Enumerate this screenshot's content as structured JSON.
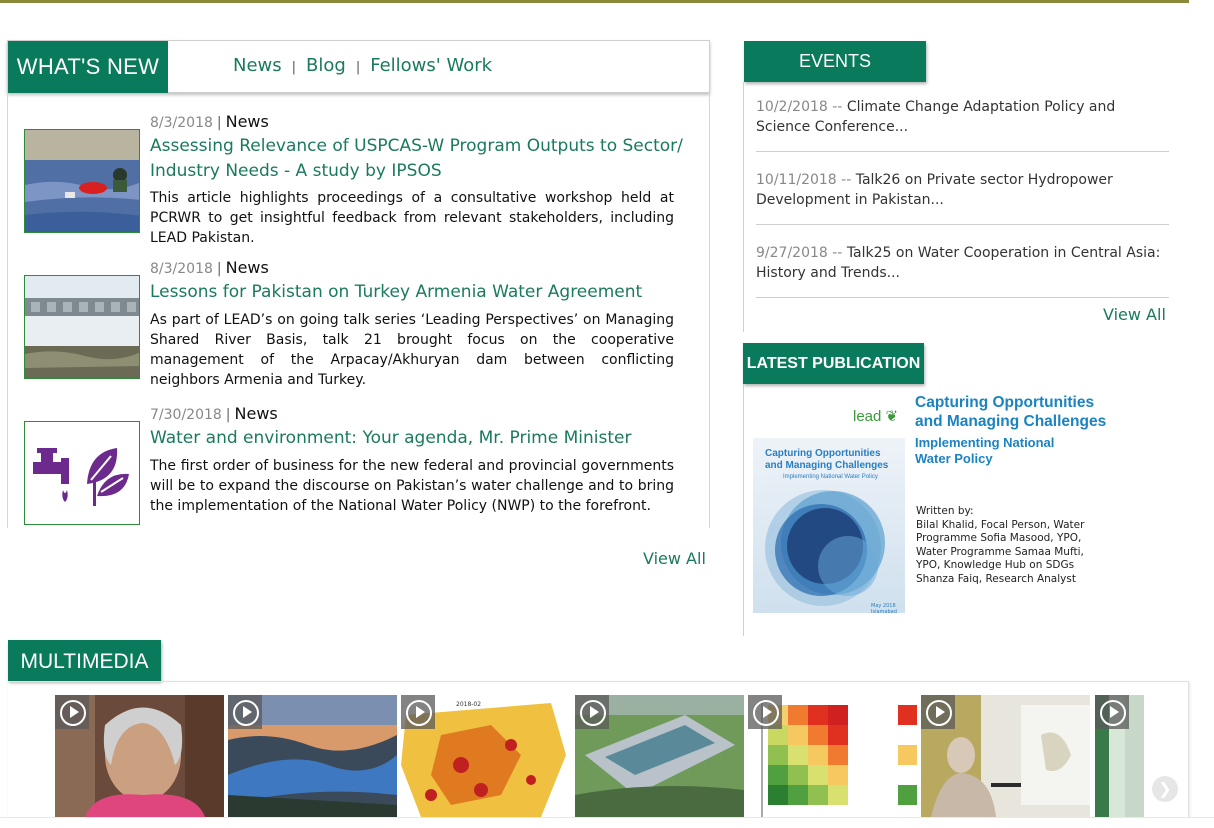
{
  "whats_new": {
    "title": "WHAT'S NEW",
    "tabs": [
      "News",
      "Blog",
      "Fellows' Work"
    ],
    "tab_separator": "|",
    "articles": [
      {
        "date": "8/3/2018",
        "category": "News",
        "title": "Assessing Relevance of USPCAS-W Program Outputs to Sector/ Industry Needs - A study by IPSOS",
        "body": "This article highlights proceedings of a consultative workshop held at PCRWR to get insightful feedback from relevant stakeholders, including LEAD Pakistan."
      },
      {
        "date": "8/3/2018",
        "category": "News",
        "title": "Lessons for Pakistan on Turkey Armenia Water Agreement",
        "body": "As part of LEAD’s on going talk series ‘Leading Perspectives’ on Managing Shared River Basis, talk 21 brought focus on the cooperative management of the Arpacay/Akhuryan dam between conflicting neighbors Armenia and Turkey."
      },
      {
        "date": "7/30/2018",
        "category": "News",
        "title": "Water and environment: Your agenda, Mr. Prime Minister",
        "body": "The first order of business for the new federal and provincial governments will be to expand the discourse on Pakistan’s water challenge and to bring the implementation of the National Water Policy (NWP) to the forefront."
      }
    ],
    "view_all": "View All"
  },
  "events": {
    "title": "EVENTS",
    "items": [
      {
        "date": "10/2/2018",
        "sep": " -- ",
        "text": "Climate Change Adaptation Policy and Science Conference..."
      },
      {
        "date": "10/11/2018",
        "sep": " -- ",
        "text": "Talk26 on Private sector Hydropower Development in Pakistan..."
      },
      {
        "date": "9/27/2018",
        "sep": " -- ",
        "text": "Talk25 on Water Cooperation in Central Asia: History and Trends..."
      }
    ],
    "view_all": "View All"
  },
  "latest_publication": {
    "title": "LATEST PUBLICATION",
    "logo_text": "lead",
    "heading": "Capturing Opportunities and Managing Challenges",
    "subheading": "Implementing National Water Policy",
    "cover_title": "Capturing Opportunities and Managing Challenges",
    "cover_subtitle": "Implementing National Water Policy",
    "cover_date": "May 2018 Islamabad",
    "written_by_label": "Written by:",
    "authors": "Bilal Khalid, Focal Person, Water Programme Sofia Masood, YPO, Water Programme Samaa Mufti, YPO, Knowledge Hub on SDGs Shanza Faiq, Research Analyst"
  },
  "multimedia": {
    "title": "MULTIMEDIA",
    "map_label": "2018-02"
  },
  "colors": {
    "brand_green": "#0a7a5c",
    "link_green": "#1a7a5e",
    "pub_blue": "#1b83c2"
  },
  "icons": {
    "play": "play-circle-icon",
    "next": "chevron-right-icon"
  }
}
